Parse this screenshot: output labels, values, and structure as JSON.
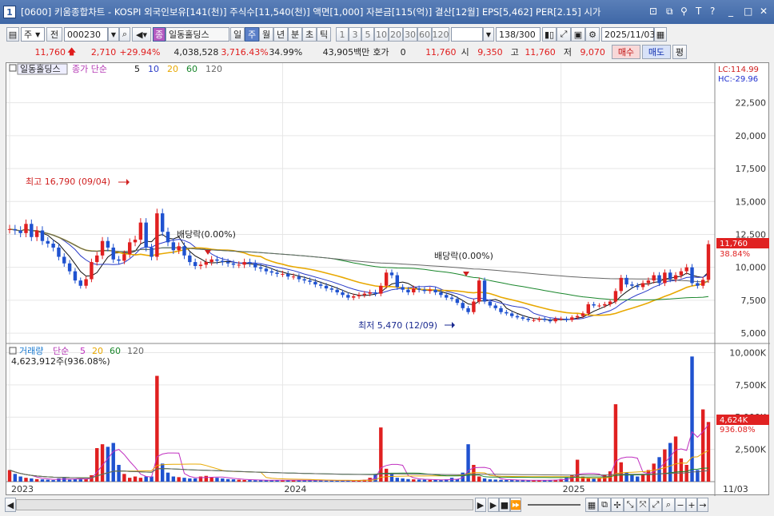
{
  "window": {
    "number": "1",
    "title": "[0600] 키움종합차트 - KOSPI 외국인보유[141(천)] 주식수[11,540(천)] 액면[1,000] 자본금[115(억)] 결산[12월] EPS[5,462] PER[2.15] 시가"
  },
  "toolbar": {
    "period_dropdown": "주",
    "prev_label": "전",
    "code": "000230",
    "stock_name_btn": "종",
    "stock_name": "일동홀딩스",
    "period_tabs": [
      "일",
      "주",
      "월",
      "년",
      "분",
      "초",
      "틱"
    ],
    "selected_period": "주",
    "interval_buttons": [
      "1",
      "3",
      "5",
      "10",
      "20",
      "30",
      "60",
      "120"
    ],
    "count_display": "138/300",
    "date": "2025/11/03"
  },
  "pricebar": {
    "price": "11,760",
    "change": "2,710",
    "change_pct": "+29.94%",
    "volume": "4,038,528",
    "volume_pct": "3,716.43%",
    "turnover_pct": "34.99%",
    "amount": "43,905백만",
    "hoga_label": "호가",
    "hoga_value": "0",
    "hoga_price": "11,760",
    "open_label": "시",
    "open_value": "9,350",
    "high_label": "고",
    "high_value": "11,760",
    "low_label": "저",
    "low_value": "9,070",
    "buy_label": "매수",
    "sell_label": "매도",
    "eval_label": "평"
  },
  "price_panel": {
    "stock_tag": "일동홀딩스",
    "legend_label": "종가 단순",
    "ma_periods": [
      "5",
      "10",
      "20",
      "60",
      "120"
    ],
    "ma_colors": [
      "#111111",
      "#2b3cc8",
      "#e8a800",
      "#19862b",
      "#666666"
    ],
    "lc": "LC:114.99",
    "hc": "HC:-29.96",
    "price_tag": "11,760",
    "pct_tag": "38.84%",
    "annotation_high": "최고 16,790 (09/04)",
    "annotation_low": "최저 5,470 (12/09)",
    "dividend_1": "배당락(0.00%)",
    "dividend_2": "배당락(0.00%)"
  },
  "volume_panel": {
    "label": "거래량",
    "legend_label": "단순",
    "ma_periods": [
      "5",
      "20",
      "60",
      "120"
    ],
    "value_text": "4,623,912주(936.08%)",
    "volume_tag": "4,624K",
    "pct_tag": "936.08%"
  },
  "x_axis": [
    "2023",
    "2024",
    "2025",
    "11/03"
  ],
  "chart_data": [
    {
      "type": "candlestick",
      "title": "",
      "ylabel": "",
      "yticks": [
        5000,
        7500,
        10000,
        12500,
        15000,
        17500,
        20000,
        22500
      ],
      "ylim": [
        4400,
        24600
      ],
      "x_labels": [
        "2023",
        "2024",
        "2025"
      ],
      "max": {
        "value": 16790,
        "date": "09/04"
      },
      "min": {
        "value": 5470,
        "date": "12/09"
      },
      "last_close": 11760,
      "ma_values_approx": {
        "ma60_end": 7600,
        "ma120_end": 9200
      },
      "weekly_close_approx": [
        12900,
        12800,
        12600,
        13300,
        12300,
        12800,
        12000,
        11800,
        11500,
        10800,
        10300,
        9700,
        9000,
        8600,
        9100,
        10400,
        10900,
        12000,
        11500,
        10600,
        10500,
        11000,
        11900,
        12100,
        13400,
        11500,
        10800,
        14100,
        12700,
        11900,
        11300,
        11600,
        10900,
        10400,
        10100,
        10200,
        10400,
        10600,
        10500,
        10400,
        10300,
        10200,
        10200,
        10400,
        10300,
        10000,
        9900,
        9700,
        9600,
        9500,
        9500,
        9300,
        9300,
        9100,
        9000,
        8900,
        8700,
        8600,
        8400,
        8300,
        8100,
        7900,
        7700,
        7800,
        7900,
        8000,
        8100,
        8000,
        8600,
        9600,
        9400,
        8500,
        8300,
        8100,
        8400,
        8300,
        8200,
        8300,
        8100,
        7900,
        7700,
        7600,
        7300,
        6900,
        6600,
        7400,
        9000,
        7400,
        7100,
        6900,
        6600,
        6500,
        6300,
        6200,
        6100,
        6000,
        6000,
        6100,
        6000,
        5900,
        6100,
        6100,
        6000,
        6200,
        6300,
        6500,
        7200,
        7100,
        7100,
        7200,
        7400,
        8200,
        9200,
        8700,
        8600,
        8500,
        8800,
        9000,
        9400,
        8800,
        9600,
        9100,
        9400,
        9700,
        10000,
        8800,
        8600,
        9050,
        11760
      ]
    },
    {
      "type": "bar",
      "title": "거래량",
      "yticks": [
        "2,500K",
        "5,000K",
        "7,500K",
        "10,000K"
      ],
      "ylim": [
        0,
        10400
      ],
      "unit": "K",
      "last_volume": 4624,
      "weekly_volume_approx_k": [
        900,
        600,
        400,
        300,
        250,
        200,
        180,
        150,
        120,
        250,
        300,
        150,
        200,
        180,
        200,
        500,
        2600,
        2900,
        2700,
        3000,
        1300,
        600,
        300,
        400,
        300,
        400,
        400,
        8200,
        1400,
        700,
        400,
        350,
        300,
        250,
        250,
        400,
        450,
        350,
        300,
        250,
        200,
        180,
        150,
        130,
        120,
        110,
        100,
        95,
        95,
        120,
        110,
        100,
        95,
        90,
        120,
        130,
        110,
        90,
        80,
        90,
        100,
        80,
        85,
        90,
        120,
        150,
        300,
        600,
        4200,
        1000,
        600,
        300,
        250,
        200,
        180,
        160,
        150,
        140,
        130,
        120,
        180,
        300,
        200,
        700,
        2900,
        1300,
        400,
        250,
        180,
        160,
        140,
        130,
        120,
        110,
        110,
        100,
        105,
        110,
        120,
        130,
        150,
        200,
        300,
        500,
        1700,
        400,
        300,
        250,
        300,
        500,
        800,
        6000,
        1500,
        700,
        500,
        400,
        600,
        900,
        1400,
        1900,
        2500,
        3000,
        3500,
        1800,
        1300,
        9700,
        900,
        5600,
        4624
      ]
    }
  ]
}
